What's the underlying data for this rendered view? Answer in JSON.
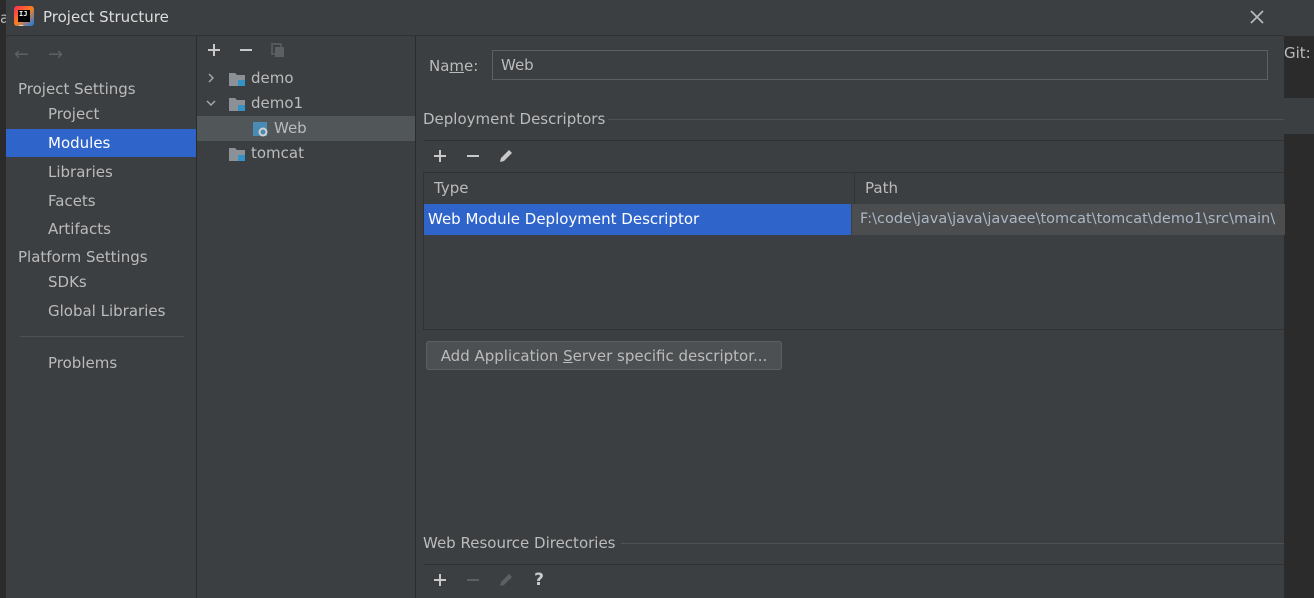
{
  "window": {
    "title": "Project Structure"
  },
  "background": {
    "left_fragment": "a",
    "right_fragment": "Git:"
  },
  "nav": {
    "back_arrow": "←",
    "forward_arrow": "→",
    "project_settings_header": "Project Settings",
    "platform_settings_header": "Platform Settings",
    "project_items": [
      {
        "label": "Project",
        "selected": false
      },
      {
        "label": "Modules",
        "selected": true
      },
      {
        "label": "Libraries",
        "selected": false
      },
      {
        "label": "Facets",
        "selected": false
      },
      {
        "label": "Artifacts",
        "selected": false
      }
    ],
    "platform_items": [
      {
        "label": "SDKs"
      },
      {
        "label": "Global Libraries"
      }
    ],
    "problems_label": "Problems"
  },
  "tree": {
    "toolbar": [
      "add-icon",
      "remove-icon",
      "copy-icon"
    ],
    "nodes": [
      {
        "label": "demo",
        "expanded": false,
        "selected": false
      },
      {
        "label": "demo1",
        "expanded": true,
        "selected": false
      },
      {
        "label": "Web",
        "child": true,
        "selected": true
      },
      {
        "label": "tomcat",
        "leaf": true,
        "selected": false
      }
    ]
  },
  "facet": {
    "name_label_pre": "Na",
    "name_label_mnemonic": "m",
    "name_label_post": "e:",
    "name_value": "Web",
    "deployment_descriptors_title": "Deployment Descriptors",
    "table": {
      "columns": [
        "Type",
        "Path"
      ],
      "rows": [
        {
          "type": "Web Module Deployment Descriptor",
          "path": "F:\\code\\java\\java\\javaee\\tomcat\\tomcat\\demo1\\src\\main\\"
        }
      ]
    },
    "add_button_pre": "Add Application ",
    "add_button_mnemonic": "S",
    "add_button_post": "erver specific descriptor...",
    "web_resource_title": "Web Resource Directories",
    "help_glyph": "?"
  },
  "colors": {
    "selection": "#2f65ca",
    "panel_bg": "#3c3f41",
    "text": "#bbbbbb"
  }
}
